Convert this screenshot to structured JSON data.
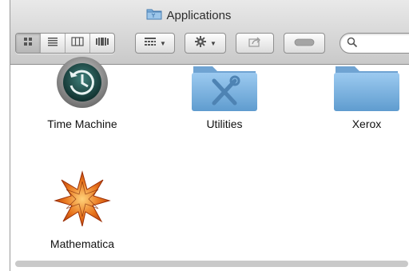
{
  "window": {
    "title": "Applications",
    "title_icon": "folder-icon"
  },
  "toolbar": {
    "view_buttons": [
      {
        "name": "icon-view",
        "icon": "grid-icon",
        "selected": true
      },
      {
        "name": "list-view",
        "icon": "list-icon",
        "selected": false
      },
      {
        "name": "column-view",
        "icon": "columns-icon",
        "selected": false
      },
      {
        "name": "cover-flow-view",
        "icon": "cover-flow-icon",
        "selected": false
      }
    ],
    "arrange_icon": "arrange-grid-icon",
    "action_icon": "gear-icon",
    "share_icon": "share-icon",
    "tag_icon": "tag-pill-icon",
    "search": {
      "value": "",
      "placeholder": "",
      "icon": "magnifier-icon"
    }
  },
  "items": [
    {
      "label": "Time Machine",
      "icon": "time-machine-icon"
    },
    {
      "label": "Utilities",
      "icon": "utilities-folder-icon"
    },
    {
      "label": "Xerox",
      "icon": "folder-icon"
    },
    {
      "label": "Mathematica",
      "icon": "mathematica-icon"
    }
  ],
  "colors": {
    "folder": "#7fb2dd",
    "folder_dark": "#5a93c6",
    "chrome_top": "#e9e9e9",
    "chrome_bottom": "#c9c9c9"
  }
}
